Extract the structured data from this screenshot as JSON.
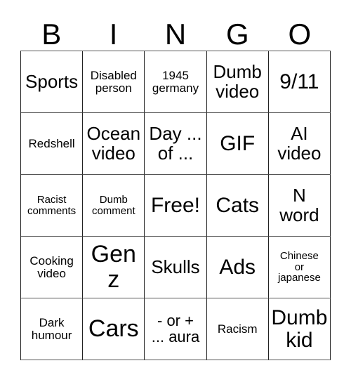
{
  "card": {
    "header_letters": [
      "B",
      "I",
      "N",
      "G",
      "O"
    ],
    "free_space_label": "Free!",
    "rows": [
      [
        {
          "text": "Sports",
          "size": "fs-lg"
        },
        {
          "text": "Disabled\nperson",
          "size": "fs-sm"
        },
        {
          "text": "1945\ngermany",
          "size": "fs-sm"
        },
        {
          "text": "Dumb\nvideo",
          "size": "fs-lg"
        },
        {
          "text": "9/11",
          "size": "fs-xl"
        }
      ],
      [
        {
          "text": "Redshell",
          "size": "fs-sm"
        },
        {
          "text": "Ocean\nvideo",
          "size": "fs-lg"
        },
        {
          "text": "Day ...\nof ...",
          "size": "fs-lg"
        },
        {
          "text": "GIF",
          "size": "fs-xl"
        },
        {
          "text": "AI\nvideo",
          "size": "fs-lg"
        }
      ],
      [
        {
          "text": "Racist\ncomments",
          "size": "fs-xs"
        },
        {
          "text": "Dumb\ncomment",
          "size": "fs-xs"
        },
        {
          "text": "Free!",
          "size": "fs-xl"
        },
        {
          "text": "Cats",
          "size": "fs-xl"
        },
        {
          "text": "N\nword",
          "size": "fs-lg"
        }
      ],
      [
        {
          "text": "Cooking\nvideo",
          "size": "fs-sm"
        },
        {
          "text": "Gen\nz",
          "size": "fs-xxl"
        },
        {
          "text": "Skulls",
          "size": "fs-lg"
        },
        {
          "text": "Ads",
          "size": "fs-xl"
        },
        {
          "text": "Chinese\nor\njapanese",
          "size": "fs-xs"
        }
      ],
      [
        {
          "text": "Dark\nhumour",
          "size": "fs-sm"
        },
        {
          "text": "Cars",
          "size": "fs-xxl"
        },
        {
          "text": "- or +\n... aura",
          "size": "fs-md"
        },
        {
          "text": "Racism",
          "size": "fs-sm"
        },
        {
          "text": "Dumb\nkid",
          "size": "fs-xl"
        }
      ]
    ]
  }
}
